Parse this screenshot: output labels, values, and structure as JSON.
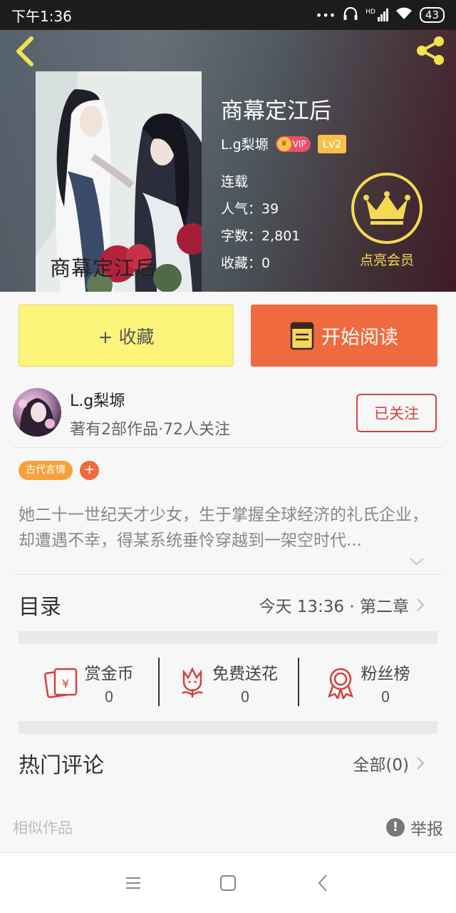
{
  "status_bar": {
    "time": "下午1:36",
    "signal": "HD",
    "battery": "43"
  },
  "book": {
    "title": "商幕定江后",
    "cover_title": "商幕定江后",
    "author": "L.g梨塬",
    "vip_label": "VIP",
    "level": "Lv2",
    "status": "连载",
    "popularity": "人气：39",
    "word_count": "字数：2,801",
    "favorites": "收藏：0"
  },
  "member": {
    "label": "点亮会员"
  },
  "actions": {
    "collect_label": "+ 收藏",
    "read_label": "开始阅读"
  },
  "author_card": {
    "name": "L.g梨塬",
    "meta": "著有2部作品·72人关注",
    "follow_label": "已关注"
  },
  "tags": [
    "古代言情"
  ],
  "tag_add": "+",
  "description": "她二十一世纪天才少女，生于掌握全球经济的礼氏企业，却遭遇不幸，得某系统垂怜穿越到一架空时代...",
  "catalog": {
    "title": "目录",
    "latest": "今天 13:36 · 第二章"
  },
  "stats": [
    {
      "icon": "red-envelope-icon",
      "label": "赏金币",
      "value": "0"
    },
    {
      "icon": "flower-icon",
      "label": "免费送花",
      "value": "0"
    },
    {
      "icon": "award-ribbon-icon",
      "label": "粉丝榜",
      "value": "0"
    }
  ],
  "comments": {
    "title": "热门评论",
    "all_label": "全部(0)"
  },
  "footer": {
    "similar_label": "相似作品",
    "report_label": "举报"
  },
  "colors": {
    "accent_orange": "#ef6a3f",
    "collect_yellow": "#fdf57b",
    "member_gold": "#f3da52",
    "follow_red": "#d2413c",
    "tag_orange": "#f6a23b"
  }
}
